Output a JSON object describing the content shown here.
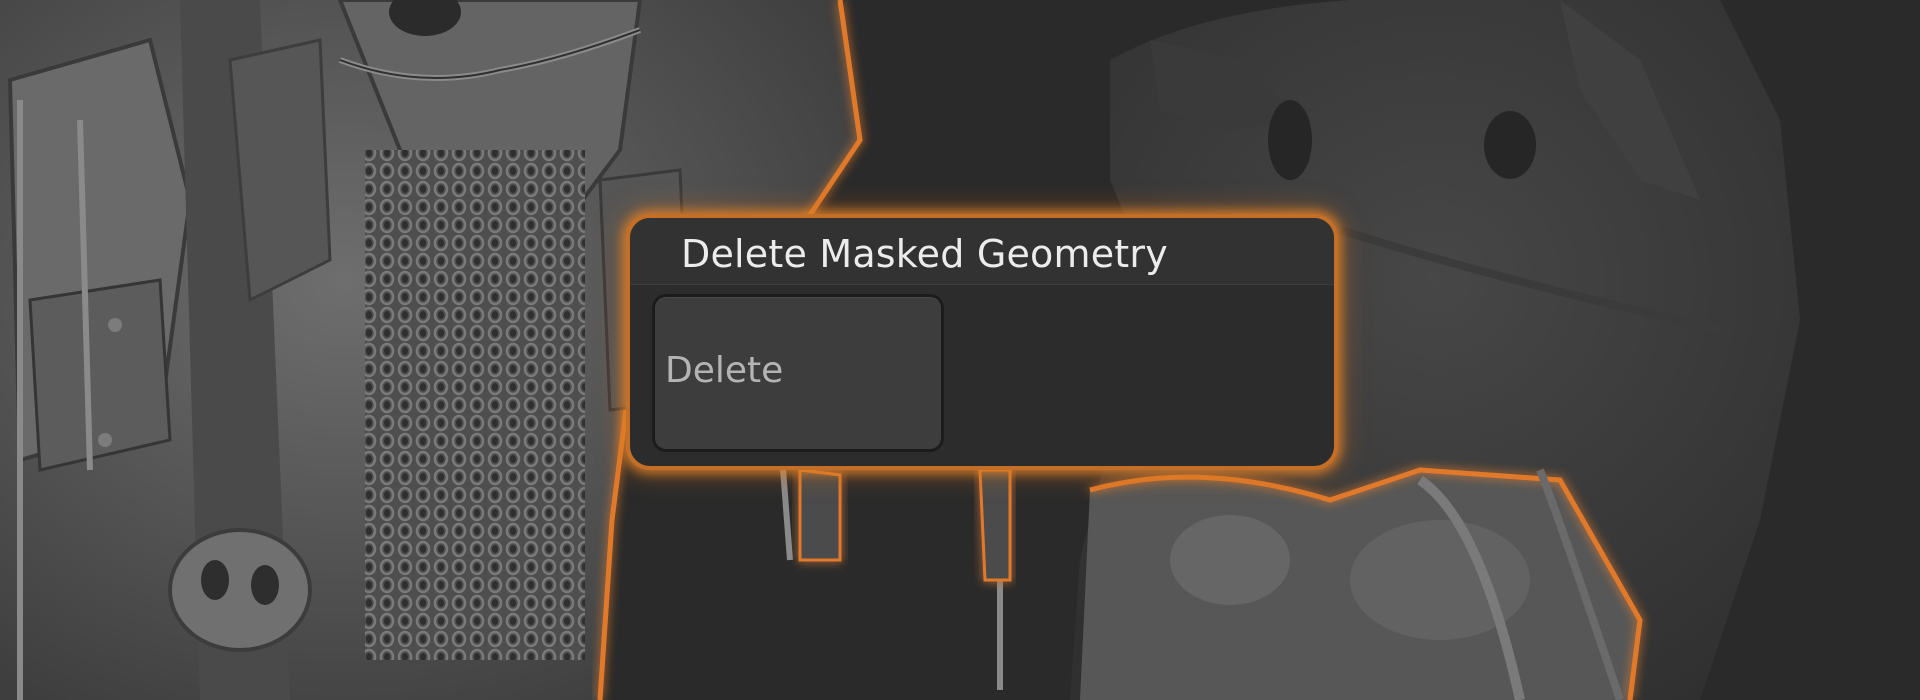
{
  "popup": {
    "title": "Delete Masked Geometry",
    "delete_button_label": "Delete"
  },
  "colors": {
    "background": "#2a2a2a",
    "sculpt_grey": "#5a5a5a",
    "highlight_orange": "#e07a2a",
    "panel_bg": "#2c2c2c",
    "button_bg": "#3d3d3d"
  },
  "icons": [
    "sculpted-armor-model",
    "sculpted-creature-model"
  ]
}
